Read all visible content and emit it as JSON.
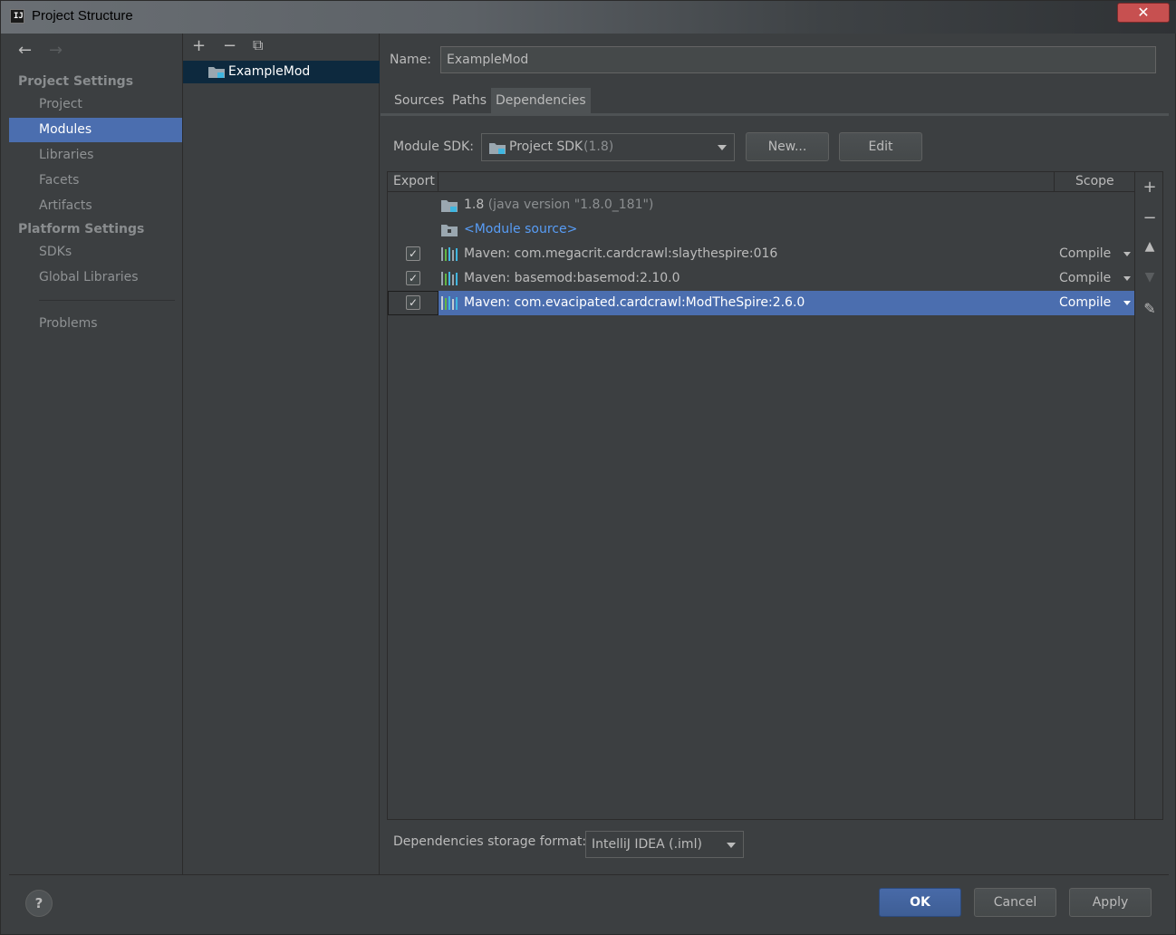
{
  "window": {
    "title": "Project Structure",
    "close_glyph": "✕"
  },
  "sidebar": {
    "sections": [
      {
        "label": "Project Settings"
      },
      {
        "label": "Platform Settings"
      }
    ],
    "items": [
      {
        "label": "Project"
      },
      {
        "label": "Modules",
        "selected": true
      },
      {
        "label": "Libraries"
      },
      {
        "label": "Facets"
      },
      {
        "label": "Artifacts"
      },
      {
        "label": "SDKs"
      },
      {
        "label": "Global Libraries"
      },
      {
        "label": "Problems"
      }
    ]
  },
  "tree": {
    "modules": [
      {
        "name": "ExampleMod",
        "icon": "module-folder-icon"
      }
    ]
  },
  "main": {
    "name_label": "Name:",
    "name_value": "ExampleMod",
    "tabs": [
      {
        "label": "Sources"
      },
      {
        "label": "Paths"
      },
      {
        "label": "Dependencies",
        "active": true
      }
    ],
    "sdk_label": "Module SDK:",
    "sdk_value": "Project SDK",
    "sdk_version": "(1.8)",
    "new_button": "New...",
    "edit_button": "Edit",
    "table": {
      "headers": {
        "export": "Export",
        "scope": "Scope"
      },
      "rows": [
        {
          "name": "1.8",
          "detail": "(java version \"1.8.0_181\")",
          "kind": "sdk",
          "checked": null,
          "scope": ""
        },
        {
          "name": "<Module source>",
          "detail": "",
          "kind": "module-source",
          "checked": null,
          "scope": ""
        },
        {
          "name": "Maven: com.megacrit.cardcrawl:slaythespire:016",
          "detail": "",
          "kind": "library",
          "checked": true,
          "scope": "Compile"
        },
        {
          "name": "Maven: basemod:basemod:2.10.0",
          "detail": "",
          "kind": "library",
          "checked": true,
          "scope": "Compile"
        },
        {
          "name": "Maven: com.evacipated.cardcrawl:ModTheSpire:2.6.0",
          "detail": "",
          "kind": "library",
          "checked": true,
          "scope": "Compile",
          "selected": true
        }
      ]
    },
    "storage_label": "Dependencies storage format:",
    "storage_value": "IntelliJ IDEA (.iml)"
  },
  "footer": {
    "help": "?",
    "ok": "OK",
    "cancel": "Cancel",
    "apply": "Apply"
  },
  "colors": {
    "selection": "#4b6eaf",
    "background": "#3c3f41",
    "link": "#589df6"
  }
}
